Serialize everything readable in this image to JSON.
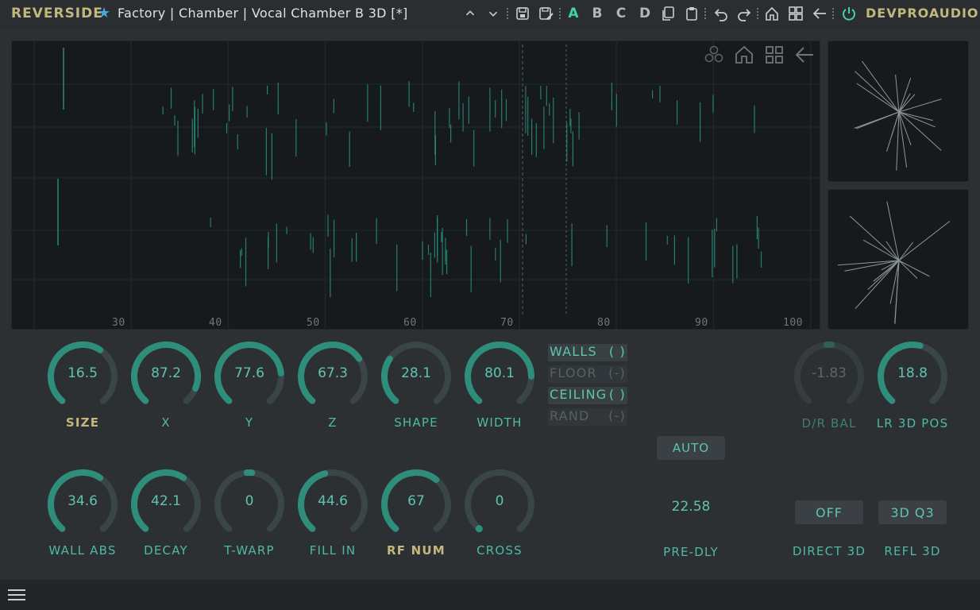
{
  "header": {
    "brand": "REVERSIDE",
    "preset": "Factory | Chamber | Vocal Chamber B 3D [*]",
    "slots": [
      "A",
      "B",
      "C",
      "D"
    ],
    "active_slot": "A",
    "vendor": "DEVPROAUDIO"
  },
  "display": {
    "x_ticks": [
      "30",
      "40",
      "50",
      "60",
      "70",
      "80",
      "90",
      "100"
    ]
  },
  "knobs_row1": [
    {
      "id": "size",
      "value": "16.5",
      "label": "SIZE",
      "fraction": 0.62,
      "gold": true
    },
    {
      "id": "x",
      "value": "87.2",
      "label": "X",
      "fraction": 0.9
    },
    {
      "id": "y",
      "value": "77.6",
      "label": "Y",
      "fraction": 0.8
    },
    {
      "id": "z",
      "value": "67.3",
      "label": "Z",
      "fraction": 0.7
    },
    {
      "id": "shape",
      "value": "28.1",
      "label": "SHAPE",
      "fraction": 0.3
    },
    {
      "id": "width",
      "value": "80.1",
      "label": "WIDTH",
      "fraction": 0.82
    }
  ],
  "knobs_row2": [
    {
      "id": "wall-abs",
      "value": "34.6",
      "label": "WALL ABS",
      "fraction": 0.62
    },
    {
      "id": "decay",
      "value": "42.1",
      "label": "DECAY",
      "fraction": 0.62
    },
    {
      "id": "t-warp",
      "value": "0",
      "label": "T-WARP",
      "fraction": 0.5
    },
    {
      "id": "fill-in",
      "value": "44.6",
      "label": "FILL IN",
      "fraction": 0.45
    },
    {
      "id": "rf-num",
      "value": "67",
      "label": "RF NUM",
      "fraction": 0.64,
      "gold": true
    },
    {
      "id": "cross",
      "value": "0",
      "label": "CROSS",
      "fraction": 0.0
    }
  ],
  "switches": [
    {
      "label": "WALLS",
      "state": "( )",
      "on": true
    },
    {
      "label": "FLOOR",
      "state": "(-)",
      "on": false
    },
    {
      "label": "CEILING",
      "state": "( )",
      "on": true
    },
    {
      "label": "RAND",
      "state": "(-)",
      "on": false
    }
  ],
  "right_knobs": [
    {
      "id": "dr-bal",
      "value": "-1.83",
      "label": "D/R BAL",
      "fraction": 0.5,
      "dim": true
    },
    {
      "id": "lr-3d-pos",
      "value": "18.8",
      "label": "LR 3D POS",
      "fraction": 0.55
    }
  ],
  "auto_label": "AUTO",
  "predly": {
    "value": "22.58",
    "label": "PRE-DLY"
  },
  "direct3d": {
    "value": "OFF",
    "label": "DIRECT 3D"
  },
  "refl3d": {
    "value": "3D Q3",
    "label": "REFL 3D"
  },
  "colors": {
    "accent": "#5ec4b0",
    "gold": "#c3b77e",
    "track": "#3a4547",
    "fill": "#2e8e7b"
  }
}
